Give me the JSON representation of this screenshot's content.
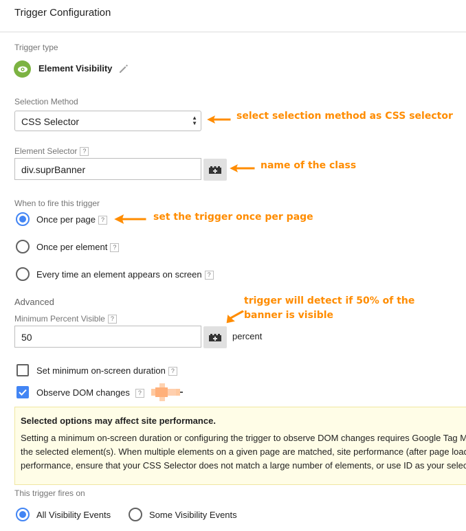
{
  "header": {
    "title": "Trigger Configuration"
  },
  "trigger_type": {
    "label": "Trigger type",
    "name": "Element Visibility",
    "icon": "eye-icon",
    "edit_icon": "pencil-icon",
    "icon_color": "#7cb342"
  },
  "selection_method": {
    "label": "Selection Method",
    "value": "CSS Selector"
  },
  "element_selector": {
    "label": "Element Selector",
    "help": "?",
    "value": "div.suprBanner",
    "variable_icon": "variable-brick-icon"
  },
  "fire": {
    "label": "When to fire this trigger",
    "options": [
      {
        "label": "Once per page",
        "help": "?",
        "selected": true
      },
      {
        "label": "Once per element",
        "help": "?",
        "selected": false
      },
      {
        "label": "Every time an element appears on screen",
        "help": "?",
        "selected": false
      }
    ]
  },
  "advanced": {
    "heading": "Advanced",
    "min_percent_label": "Minimum Percent Visible",
    "min_percent_help": "?",
    "min_percent_value": "50",
    "min_percent_unit": "percent",
    "min_duration_label": "Set minimum on-screen duration",
    "min_duration_help": "?",
    "min_duration_checked": false,
    "observe_dom_label": "Observe DOM changes",
    "observe_dom_help": "?",
    "observe_dom_checked": true
  },
  "warning": {
    "title": "Selected options may affect site performance.",
    "lines": [
      "Setting a minimum on-screen duration or configuring the trigger to observe DOM changes requires Google Tag M",
      "the selected element(s). When multiple elements on a given page are matched, site performance (after page load",
      "performance, ensure that your CSS Selector does not match a large number of elements, or use ID as your selecti"
    ]
  },
  "fires_on": {
    "label": "This trigger fires on",
    "options": [
      {
        "label": "All Visibility Events",
        "selected": true
      },
      {
        "label": "Some Visibility Events",
        "selected": false
      }
    ]
  },
  "annotations": {
    "selection_method": "select selection method as CSS selector",
    "element_selector": "name of the class",
    "fire": "set the trigger once per page",
    "percent_line1": "trigger will detect if 50% of the",
    "percent_line2": "banner is visible"
  },
  "colors": {
    "accent": "#4285f4",
    "annotation": "#ff8c00",
    "warning_bg": "#fffde7"
  }
}
